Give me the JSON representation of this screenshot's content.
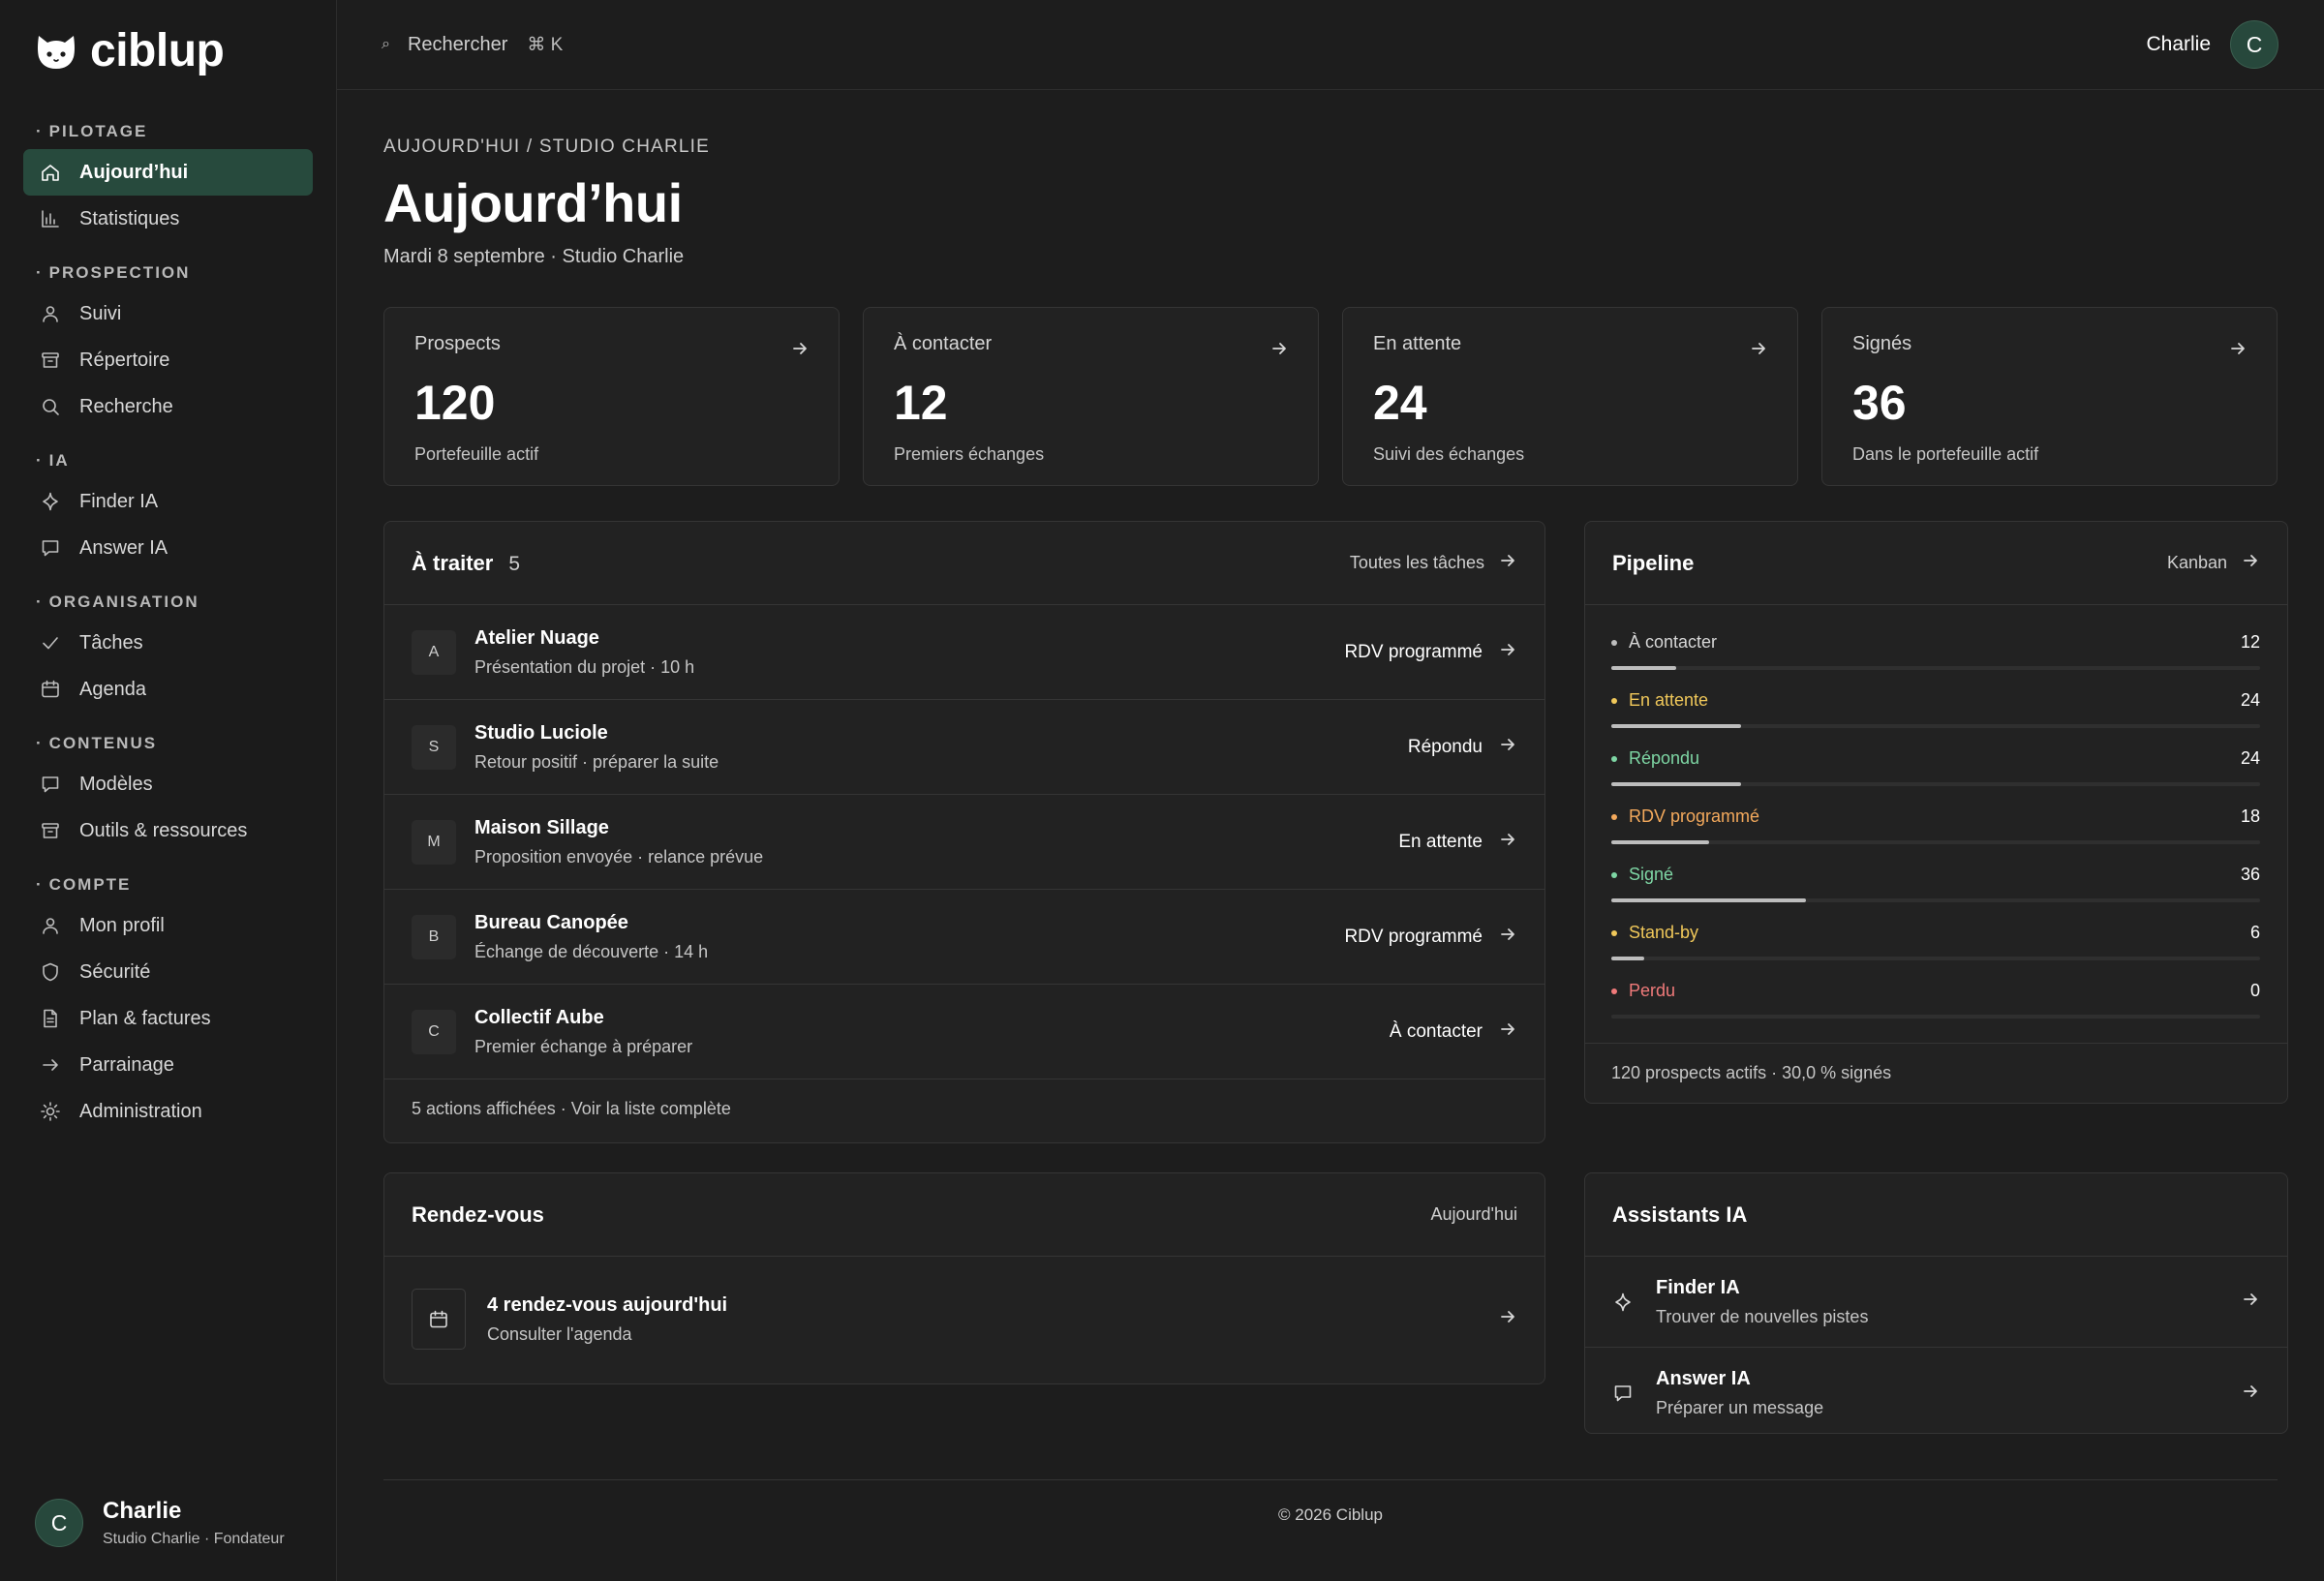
{
  "brand": {
    "name": "ciblup",
    "logo_icon": "cat-head-logo-icon"
  },
  "colors": {
    "accent": "#274a3d",
    "status_neutral": "#bdbdbd",
    "status_waiting": "#f0c85a",
    "status_replied": "#7ed6a4",
    "status_meeting": "#f3a95c",
    "status_signed": "#7ed6a4",
    "status_standby": "#f0c85a",
    "status_lost": "#f07a7a"
  },
  "sidebar": {
    "sections": [
      {
        "heading": "PILOTAGE",
        "items": [
          {
            "label": "Aujourd’hui",
            "icon": "home-icon",
            "active": true
          },
          {
            "label": "Statistiques",
            "icon": "bar-chart-icon"
          }
        ]
      },
      {
        "heading": "PROSPECTION",
        "items": [
          {
            "label": "Suivi",
            "icon": "user-icon"
          },
          {
            "label": "Répertoire",
            "icon": "archive-icon"
          },
          {
            "label": "Recherche",
            "icon": "search-icon"
          }
        ]
      },
      {
        "heading": "IA",
        "items": [
          {
            "label": "Finder IA",
            "icon": "sparkle-icon"
          },
          {
            "label": "Answer IA",
            "icon": "chat-icon"
          }
        ]
      },
      {
        "heading": "ORGANISATION",
        "items": [
          {
            "label": "Tâches",
            "icon": "check-icon"
          },
          {
            "label": "Agenda",
            "icon": "calendar-icon"
          }
        ]
      },
      {
        "heading": "CONTENUS",
        "items": [
          {
            "label": "Modèles",
            "icon": "chat-icon"
          },
          {
            "label": "Outils & ressources",
            "icon": "archive-icon"
          }
        ]
      },
      {
        "heading": "COMPTE",
        "items": [
          {
            "label": "Mon profil",
            "icon": "user-icon"
          },
          {
            "label": "Sécurité",
            "icon": "shield-icon"
          },
          {
            "label": "Plan & factures",
            "icon": "file-icon"
          },
          {
            "label": "Parrainage",
            "icon": "arrow-right-icon"
          },
          {
            "label": "Administration",
            "icon": "sun-icon"
          }
        ]
      }
    ],
    "user": {
      "initial": "C",
      "name": "Charlie",
      "subtitle": "Studio Charlie · Fondateur"
    }
  },
  "topbar": {
    "search_label": "Rechercher",
    "search_shortcut": "⌘ K",
    "user_name": "Charlie",
    "user_initial": "C"
  },
  "page": {
    "breadcrumb": "AUJOURD'HUI / STUDIO CHARLIE",
    "title": "Aujourd’hui",
    "subtitle": "Mardi 8 septembre · Studio Charlie"
  },
  "stats": [
    {
      "label": "Prospects",
      "value": "120",
      "note": "Portefeuille actif"
    },
    {
      "label": "À contacter",
      "value": "12",
      "note": "Premiers échanges"
    },
    {
      "label": "En attente",
      "value": "24",
      "note": "Suivi des échanges"
    },
    {
      "label": "Signés",
      "value": "36",
      "note": "Dans le portefeuille actif"
    }
  ],
  "tasks": {
    "title": "À traiter",
    "count": "5",
    "link": "Toutes les tâches",
    "items": [
      {
        "initial": "A",
        "name": "Atelier Nuage",
        "desc": "Présentation du projet · 10 h",
        "status": "RDV programmé"
      },
      {
        "initial": "S",
        "name": "Studio Luciole",
        "desc": "Retour positif · préparer la suite",
        "status": "Répondu"
      },
      {
        "initial": "M",
        "name": "Maison Sillage",
        "desc": "Proposition envoyée · relance prévue",
        "status": "En attente"
      },
      {
        "initial": "B",
        "name": "Bureau Canopée",
        "desc": "Échange de découverte · 14 h",
        "status": "RDV programmé"
      },
      {
        "initial": "C",
        "name": "Collectif Aube",
        "desc": "Premier échange à préparer",
        "status": "À contacter"
      }
    ],
    "footer": "5 actions affichées · Voir la liste complète"
  },
  "pipeline": {
    "title": "Pipeline",
    "link": "Kanban",
    "total": 120,
    "stages": [
      {
        "label": "À contacter",
        "value": 12,
        "color": "#bdbdbd",
        "label_color": "#d6d6d6"
      },
      {
        "label": "En attente",
        "value": 24,
        "color": "#f0c85a",
        "label_color": "#f0c85a"
      },
      {
        "label": "Répondu",
        "value": 24,
        "color": "#7ed6a4",
        "label_color": "#7ed6a4"
      },
      {
        "label": "RDV programmé",
        "value": 18,
        "color": "#f3a95c",
        "label_color": "#f3a95c"
      },
      {
        "label": "Signé",
        "value": 36,
        "color": "#7ed6a4",
        "label_color": "#7ed6a4"
      },
      {
        "label": "Stand-by",
        "value": 6,
        "color": "#f0c85a",
        "label_color": "#f0c85a"
      },
      {
        "label": "Perdu",
        "value": 0,
        "color": "#f07a7a",
        "label_color": "#f07a7a"
      }
    ],
    "footer": "120 prospects actifs · 30,0 % signés"
  },
  "rdv": {
    "title": "Rendez-vous",
    "tag": "Aujourd'hui",
    "card_title": "4 rendez-vous aujourd'hui",
    "card_sub": "Consulter l'agenda"
  },
  "assistants": {
    "title": "Assistants IA",
    "items": [
      {
        "title": "Finder IA",
        "sub": "Trouver de nouvelles pistes",
        "icon": "sparkle-icon"
      },
      {
        "title": "Answer IA",
        "sub": "Préparer un message",
        "icon": "chat-icon"
      }
    ]
  },
  "footer": "© 2026 Ciblup"
}
